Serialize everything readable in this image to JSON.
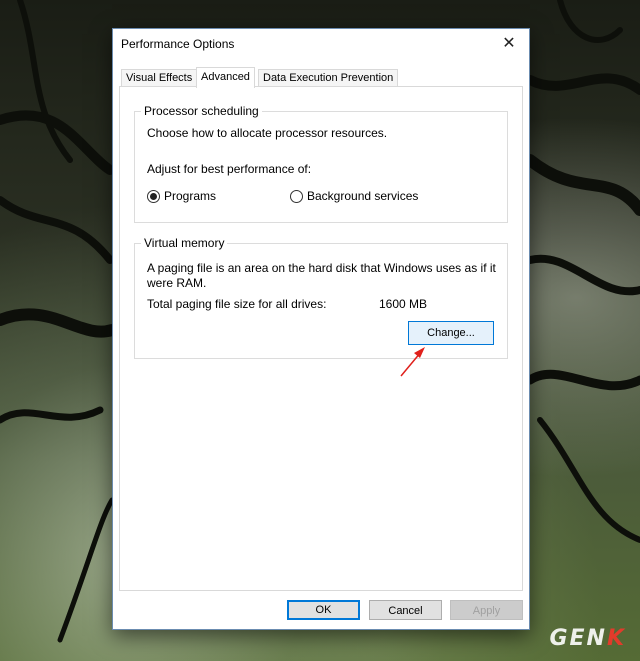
{
  "window": {
    "title": "Performance Options"
  },
  "tabs": [
    {
      "label": "Visual Effects",
      "active": false
    },
    {
      "label": "Advanced",
      "active": true
    },
    {
      "label": "Data Execution Prevention",
      "active": false
    }
  ],
  "processor": {
    "group_label": "Processor scheduling",
    "description": "Choose how to allocate processor resources.",
    "adjust_label": "Adjust for best performance of:",
    "options": [
      {
        "label": "Programs",
        "selected": true
      },
      {
        "label": "Background services",
        "selected": false
      }
    ]
  },
  "virtual_memory": {
    "group_label": "Virtual memory",
    "description": "A paging file is an area on the hard disk that Windows uses as if it were RAM.",
    "total_label": "Total paging file size for all drives:",
    "total_value": "1600 MB",
    "change_button": "Change..."
  },
  "footer": {
    "ok": "OK",
    "cancel": "Cancel",
    "apply": "Apply"
  },
  "watermark": {
    "text": "GEN",
    "accent": "K"
  },
  "colors": {
    "accent": "#0078d7",
    "annotation_arrow": "#e0201b"
  }
}
